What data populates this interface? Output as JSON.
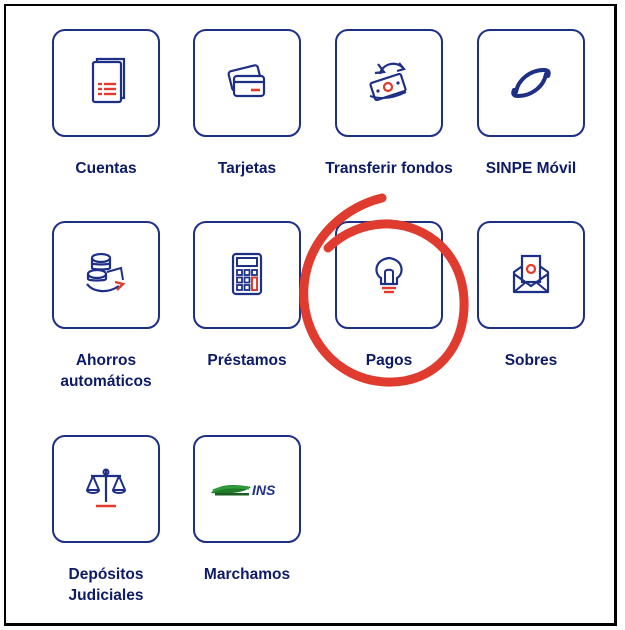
{
  "brand": {
    "primary": "#1e2f86",
    "text": "#0d1a66",
    "accent_red": "#e23a2c",
    "annotation": "#e03b2f"
  },
  "menu": {
    "items": [
      {
        "id": "cuentas",
        "label": "Cuentas",
        "icon": "document-list-icon"
      },
      {
        "id": "tarjetas",
        "label": "Tarjetas",
        "icon": "credit-cards-icon"
      },
      {
        "id": "transferir",
        "label": "Transferir fondos",
        "icon": "money-transfer-icon"
      },
      {
        "id": "sinpe",
        "label": "SINPE Móvil",
        "icon": "sinpe-logo-icon"
      },
      {
        "id": "ahorros",
        "label_line1": "Ahorros",
        "label_line2": "automáticos",
        "icon": "coins-savings-icon"
      },
      {
        "id": "prestamos",
        "label": "Préstamos",
        "icon": "calculator-icon"
      },
      {
        "id": "pagos",
        "label": "Pagos",
        "icon": "lightbulb-icon"
      },
      {
        "id": "sobres",
        "label": "Sobres",
        "icon": "envelope-money-icon"
      },
      {
        "id": "depositos",
        "label_line1": "Depósitos",
        "label_line2": "Judiciales",
        "icon": "scales-icon"
      },
      {
        "id": "marchamos",
        "label": "Marchamos",
        "icon": "ins-logo-icon",
        "logo_text": "INS"
      }
    ]
  }
}
